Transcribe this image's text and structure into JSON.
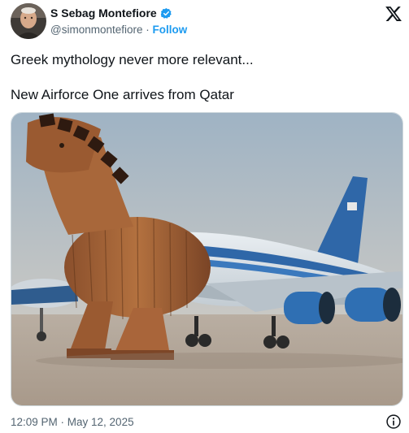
{
  "author": {
    "name": "S Sebag Montefiore",
    "handle": "@simonmontefiore",
    "separator": "·",
    "follow_label": "Follow",
    "verified_color": "#1d9bf0"
  },
  "platform_icon": "x-logo-icon",
  "tweet": {
    "lines": [
      "Greek mythology never more relevant...",
      "New Airforce One arrives from Qatar"
    ]
  },
  "media": {
    "kind": "image",
    "subject": "wooden-horse-airplane-image"
  },
  "footer": {
    "timestamp": "12:09 PM · May 12, 2025",
    "info_icon": "info-icon"
  },
  "colors": {
    "text": "#0f1419",
    "secondary": "#536471",
    "accent": "#1d9bf0",
    "border": "#cfd9de"
  }
}
